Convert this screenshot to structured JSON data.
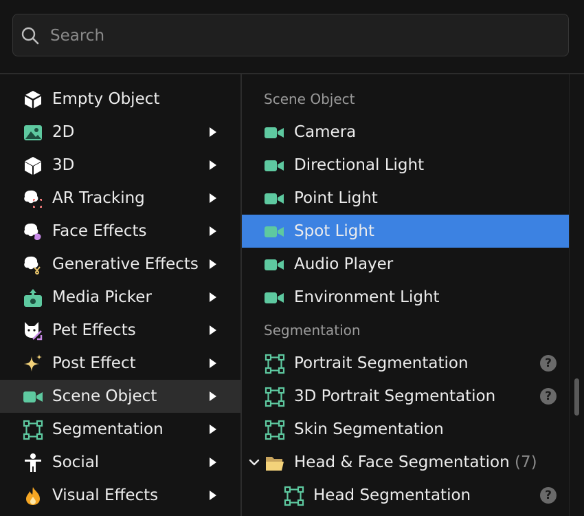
{
  "search": {
    "placeholder": "Search",
    "value": ""
  },
  "categories": [
    {
      "label": "Empty Object",
      "icon": "cube-outline-icon",
      "has_submenu": false
    },
    {
      "label": "2D",
      "icon": "image-icon",
      "has_submenu": true
    },
    {
      "label": "3D",
      "icon": "cube-icon",
      "has_submenu": true
    },
    {
      "label": "AR Tracking",
      "icon": "ar-tracking-icon",
      "has_submenu": true
    },
    {
      "label": "Face Effects",
      "icon": "face-effects-icon",
      "has_submenu": true
    },
    {
      "label": "Generative Effects",
      "icon": "generative-effects-icon",
      "has_submenu": true
    },
    {
      "label": "Media Picker",
      "icon": "media-picker-icon",
      "has_submenu": true
    },
    {
      "label": "Pet Effects",
      "icon": "pet-effects-icon",
      "has_submenu": true
    },
    {
      "label": "Post Effect",
      "icon": "sparkle-icon",
      "has_submenu": true
    },
    {
      "label": "Scene Object",
      "icon": "video-camera-icon",
      "has_submenu": true,
      "active": true
    },
    {
      "label": "Segmentation",
      "icon": "segmentation-icon",
      "has_submenu": true
    },
    {
      "label": "Social",
      "icon": "person-icon",
      "has_submenu": true
    },
    {
      "label": "Visual Effects",
      "icon": "flame-icon",
      "has_submenu": true
    }
  ],
  "submenu": {
    "scene_header": "Scene Object",
    "scene_items": [
      {
        "label": "Camera",
        "icon": "video-camera-icon"
      },
      {
        "label": "Directional Light",
        "icon": "video-camera-icon"
      },
      {
        "label": "Point Light",
        "icon": "video-camera-icon"
      },
      {
        "label": "Spot Light",
        "icon": "video-camera-icon",
        "selected": true
      },
      {
        "label": "Audio Player",
        "icon": "video-camera-icon"
      },
      {
        "label": "Environment Light",
        "icon": "video-camera-icon"
      }
    ],
    "segmentation_header": "Segmentation",
    "segmentation_items": [
      {
        "label": "Portrait Segmentation",
        "icon": "segmentation-icon",
        "help": "?"
      },
      {
        "label": "3D Portrait Segmentation",
        "icon": "segmentation-icon",
        "help": "?"
      },
      {
        "label": "Skin Segmentation",
        "icon": "segmentation-icon"
      }
    ],
    "folder": {
      "label": "Head & Face Segmentation",
      "count": "(7)",
      "icon": "folder-open-icon",
      "expanded": true
    },
    "folder_items": [
      {
        "label": "Head Segmentation",
        "icon": "segmentation-icon",
        "help": "?"
      }
    ]
  },
  "colors": {
    "accent": "#3c82e2",
    "icon_green": "#5ec9a0",
    "background": "#141414"
  }
}
